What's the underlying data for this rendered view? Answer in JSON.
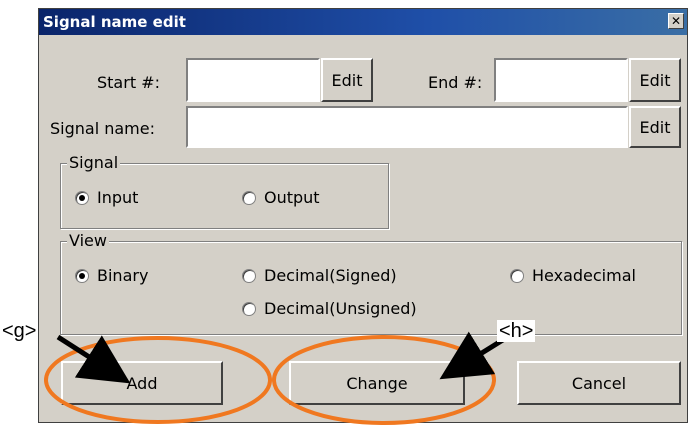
{
  "dialog": {
    "title": "Signal name edit",
    "close_glyph": "✕"
  },
  "fields": {
    "start_label": "Start #:",
    "end_label": "End #:",
    "signal_name_label": "Signal name:",
    "edit_label": "Edit"
  },
  "signal_group": {
    "title": "Signal",
    "options": [
      {
        "label": "Input",
        "checked": true
      },
      {
        "label": "Output",
        "checked": false
      }
    ]
  },
  "view_group": {
    "title": "View",
    "options": [
      {
        "label": "Binary",
        "checked": true
      },
      {
        "label": "Decimal(Signed)",
        "checked": false
      },
      {
        "label": "Hexadecimal",
        "checked": false
      },
      {
        "label": "Decimal(Unsigned)",
        "checked": false
      }
    ]
  },
  "buttons": {
    "add": "Add",
    "change": "Change",
    "cancel": "Cancel"
  },
  "annotations": {
    "g_label": "<g>",
    "h_label": "<h>",
    "highlight_color": "#f07820"
  }
}
